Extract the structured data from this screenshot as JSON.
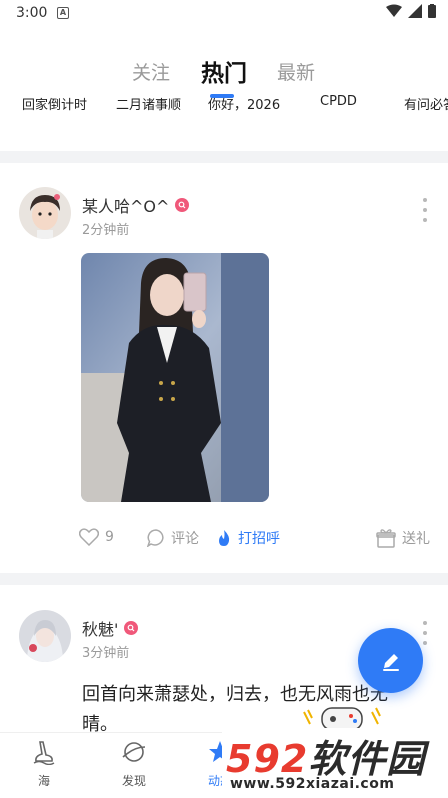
{
  "status_bar": {
    "time": "3:00",
    "notification_letter": "A"
  },
  "tabs": [
    {
      "label": "关注",
      "active": false
    },
    {
      "label": "热门",
      "active": true
    },
    {
      "label": "最新",
      "active": false
    }
  ],
  "topics": [
    "回家倒计时",
    "二月诸事顺",
    "你好，2026",
    "CPDD",
    "有问必答"
  ],
  "posts": [
    {
      "username": "某人哈^O^",
      "time_ago": "2分钟前",
      "actions": {
        "likes": "9",
        "comment": "评论",
        "greet": "打招呼",
        "gift": "送礼"
      }
    },
    {
      "username": "秋魅'",
      "time_ago": "3分钟前",
      "text": "回首向来萧瑟处，归去，也无风雨也无晴。"
    }
  ],
  "bottom_nav": [
    {
      "label": "海",
      "active": false
    },
    {
      "label": "发现",
      "active": false
    },
    {
      "label": "动态",
      "active": true
    }
  ],
  "watermark": {
    "num": "592",
    "cn": "软件园",
    "url": "www.592xiazai.com"
  },
  "colors": {
    "accent": "#2f7bf6",
    "verify": "#f0587a",
    "watermark_red": "#e83b2f"
  }
}
